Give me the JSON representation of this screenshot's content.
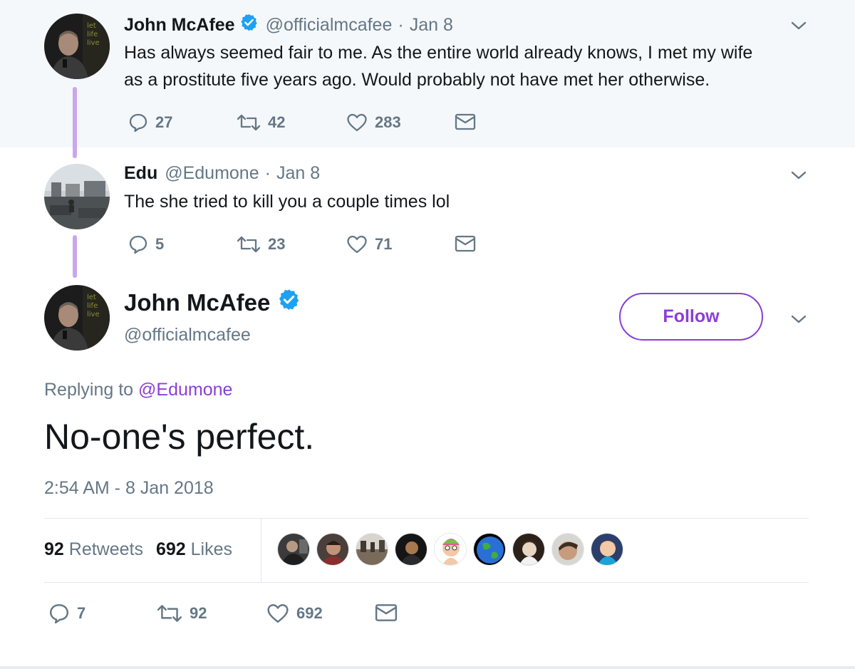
{
  "tweet1": {
    "name": "John McAfee",
    "handle": "@officialmcafee",
    "date": "Jan 8",
    "text_line1": "Has always seemed fair to me. As the entire world already knows, I met my wife",
    "text_line2": "as a prostitute five years ago. Would probably not have met her otherwise.",
    "replies": "27",
    "retweets": "42",
    "likes": "283"
  },
  "tweet2": {
    "name": "Edu",
    "handle": "@Edumone",
    "date": "Jan 8",
    "text": "The she tried to kill you a couple times lol",
    "replies": "5",
    "retweets": "23",
    "likes": "71"
  },
  "main_tweet": {
    "name": "John McAfee",
    "handle": "@officialmcafee",
    "follow_label": "Follow",
    "replying_prefix": "Replying to",
    "replying_mention": "@Edumone",
    "text": "No-one's perfect.",
    "timestamp": "2:54 AM - 8 Jan 2018",
    "retweet_count": "92",
    "retweet_label": "Retweets",
    "like_count": "692",
    "like_label": "Likes",
    "replies": "7",
    "retweets": "92",
    "likes": "692"
  },
  "avatar_text": [
    "let",
    "life",
    "live"
  ],
  "colors": {
    "accent": "#8b3ed8",
    "verified": "#1da1f2",
    "thread_line": "#c9a7ec",
    "muted": "#657786",
    "highlight_bg": "#f5f8fa"
  },
  "icons": {
    "reply": "reply-icon",
    "retweet": "retweet-icon",
    "like": "heart-icon",
    "dm": "envelope-icon",
    "caret": "chevron-down-icon",
    "verified": "verified-badge-icon"
  }
}
